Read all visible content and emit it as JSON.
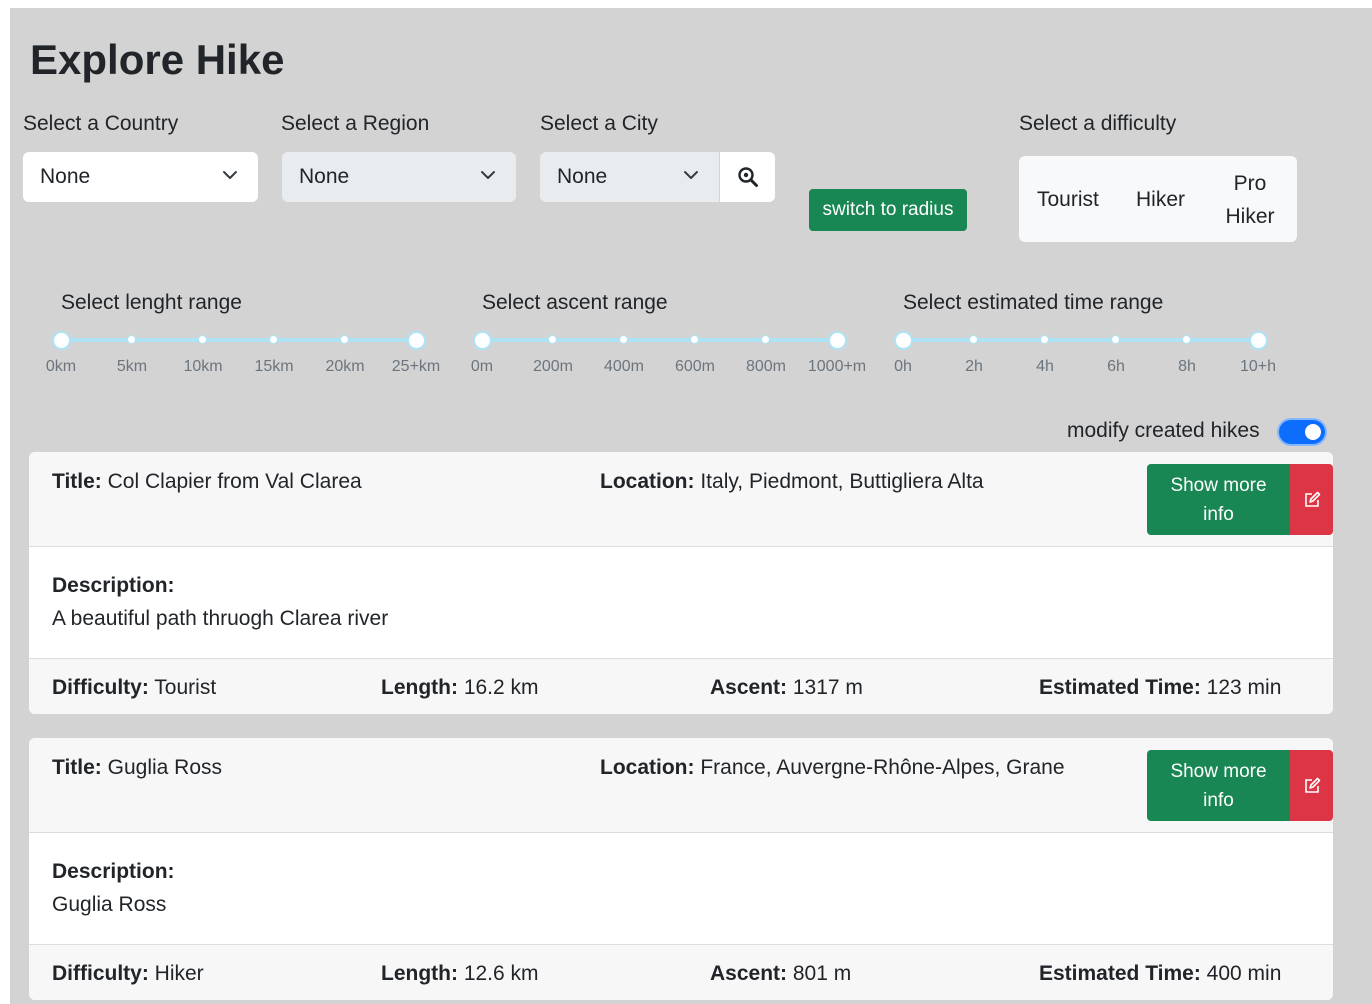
{
  "page": {
    "title": "Explore Hike"
  },
  "filters": {
    "country": {
      "label": "Select a Country",
      "value": "None"
    },
    "region": {
      "label": "Select a Region",
      "value": "None"
    },
    "city": {
      "label": "Select a City",
      "value": "None"
    },
    "radius_button": "switch to radius",
    "difficulty": {
      "label": "Select a difficulty",
      "options": [
        "Tourist",
        "Hiker",
        "Pro",
        "Hiker"
      ]
    }
  },
  "sliders": {
    "length": {
      "label": "Select lenght range",
      "ticks": [
        "0km",
        "5km",
        "10km",
        "15km",
        "20km",
        "25+km"
      ]
    },
    "ascent": {
      "label": "Select ascent range",
      "ticks": [
        "0m",
        "200m",
        "400m",
        "600m",
        "800m",
        "1000+m"
      ]
    },
    "time": {
      "label": "Select estimated time range",
      "ticks": [
        "0h",
        "2h",
        "4h",
        "6h",
        "8h",
        "10+h"
      ]
    }
  },
  "toggle": {
    "label": "modify created hikes",
    "on": true
  },
  "labels": {
    "title": "Title:",
    "location": "Location:",
    "description": "Description:",
    "difficulty": "Difficulty:",
    "length": "Length:",
    "ascent": "Ascent:",
    "time": "Estimated Time:",
    "more_line1": "Show more",
    "more_line2": "info"
  },
  "hikes": [
    {
      "title": "Col Clapier from Val Clarea",
      "location": "Italy, Piedmont, Buttigliera Alta",
      "description": "A beautiful path thruogh Clarea river",
      "difficulty": "Tourist",
      "length": "16.2 km",
      "ascent": "1317 m",
      "time": "123 min"
    },
    {
      "title": "Guglia Ross",
      "location": "France, Auvergne-Rhône-Alpes, Grane",
      "description": "Guglia Ross",
      "difficulty": "Hiker",
      "length": "12.6 km",
      "ascent": "801 m",
      "time": "400 min"
    }
  ],
  "colors": {
    "background": "#d3d3d3",
    "success": "#198754",
    "danger": "#dc3545",
    "toggle": "#0d6efd",
    "slider": "#aee3f5"
  },
  "icons": {
    "search": "zoom-search-icon",
    "dropdown": "chevron-down-icon",
    "edit": "edit-icon"
  }
}
